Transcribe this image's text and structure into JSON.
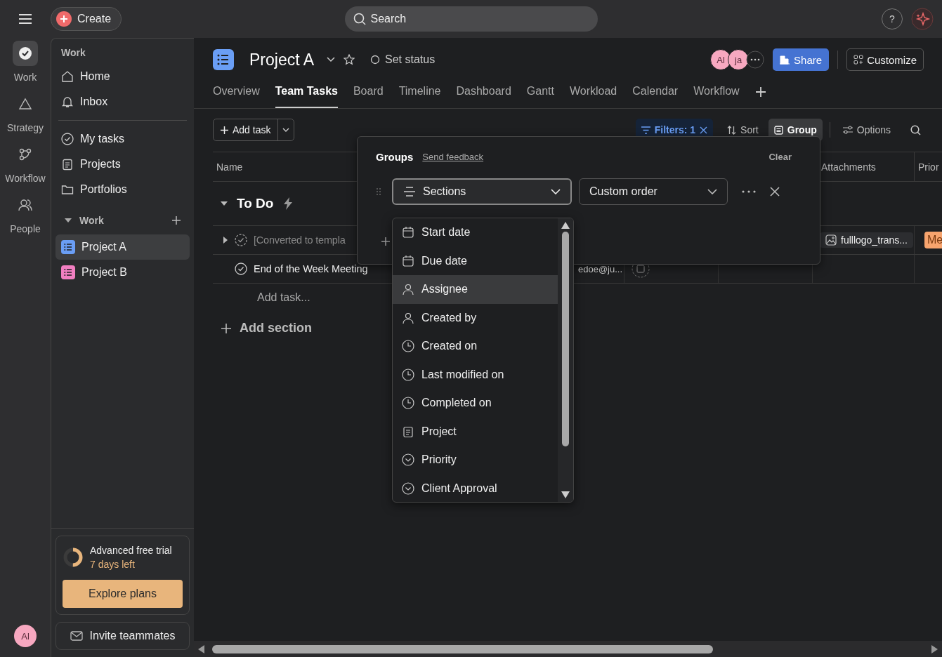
{
  "top_bar": {
    "create": "Create",
    "search_placeholder": "Search",
    "help": "?"
  },
  "rail": {
    "items": [
      {
        "label": "Work",
        "selected": true
      },
      {
        "label": "Strategy",
        "selected": false
      },
      {
        "label": "Workflow",
        "selected": false
      },
      {
        "label": "People",
        "selected": false
      }
    ],
    "avatar": "Al"
  },
  "sidebar": {
    "heading": "Work",
    "nav": [
      {
        "label": "Home"
      },
      {
        "label": "Inbox"
      }
    ],
    "links": [
      {
        "label": "My tasks"
      },
      {
        "label": "Projects"
      },
      {
        "label": "Portfolios"
      }
    ],
    "section": {
      "label": "Work",
      "expanded": true
    },
    "projects": [
      {
        "label": "Project A",
        "selected": true,
        "color": "#6a9ef5"
      },
      {
        "label": "Project B",
        "selected": false,
        "color": "#f17fc1"
      }
    ],
    "trial": {
      "title": "Advanced free trial",
      "subtitle": "7 days left",
      "level": 0.5,
      "button": "Explore plans"
    },
    "invite": "Invite teammates"
  },
  "header": {
    "title": "Project A",
    "status": "Set status",
    "members": [
      {
        "initials": "Al"
      },
      {
        "initials": "ja"
      }
    ],
    "share": "Share",
    "customize": "Customize"
  },
  "tabs": [
    {
      "label": "Overview",
      "selected": false
    },
    {
      "label": "Team Tasks",
      "selected": true
    },
    {
      "label": "Board",
      "selected": false
    },
    {
      "label": "Timeline",
      "selected": false
    },
    {
      "label": "Dashboard",
      "selected": false
    },
    {
      "label": "Gantt",
      "selected": false
    },
    {
      "label": "Workload",
      "selected": false
    },
    {
      "label": "Calendar",
      "selected": false
    },
    {
      "label": "Workflow",
      "selected": false
    }
  ],
  "toolbar": {
    "add_task": "Add task",
    "tools": [
      {
        "kind": "filter",
        "label": "Filters: 1",
        "selected": true
      },
      {
        "kind": "sort",
        "label": "Sort",
        "selected": false
      },
      {
        "kind": "group",
        "label": "Group",
        "selected": true
      },
      {
        "kind": "options",
        "label": "Options",
        "selected": false
      }
    ]
  },
  "table": {
    "columns": [
      {
        "label": "Name"
      },
      {
        "label": "Attachments"
      },
      {
        "label": "Prior"
      }
    ],
    "section": {
      "title": "To Do",
      "expanded": true
    },
    "rows": [
      {
        "kind": "template",
        "name": "[Converted to templa",
        "attachment": "fulllogo_trans...",
        "priority": {
          "label": "Me",
          "color": "#f7a46e"
        }
      },
      {
        "kind": "task",
        "name": "End of the Week Meeting",
        "assignee": "edoe@ju..."
      }
    ],
    "add_task": "Add task...",
    "add_section": "Add section"
  },
  "groups_popup": {
    "title": "Groups",
    "feedback": "Send feedback",
    "clear": "Clear",
    "group_by": "Sections",
    "order": "Custom order",
    "menu": [
      {
        "label": "Start date",
        "selected": false
      },
      {
        "label": "Due date",
        "selected": false
      },
      {
        "label": "Assignee",
        "selected": true
      },
      {
        "label": "Created by",
        "selected": false
      },
      {
        "label": "Created on",
        "selected": false
      },
      {
        "label": "Last modified on",
        "selected": false
      },
      {
        "label": "Completed on",
        "selected": false
      },
      {
        "label": "Project",
        "selected": false
      },
      {
        "label": "Priority",
        "selected": false
      },
      {
        "label": "Client Approval",
        "selected": false
      }
    ]
  }
}
